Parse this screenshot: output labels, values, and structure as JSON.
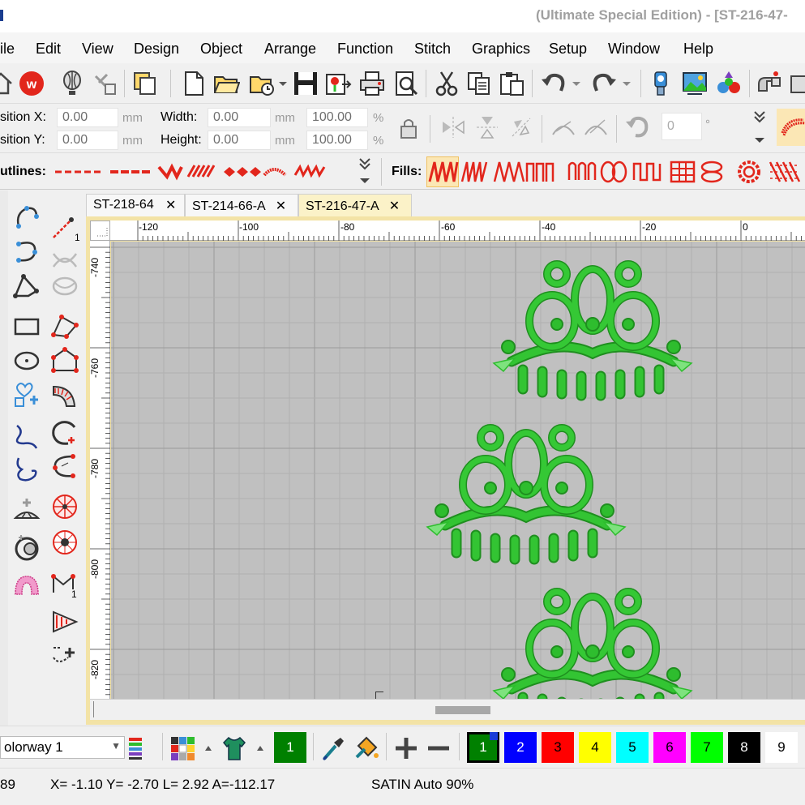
{
  "window": {
    "title": "(Ultimate Special Edition) - [ST-216-47-"
  },
  "menu": [
    "ile",
    "Edit",
    "View",
    "Design",
    "Object",
    "Arrange",
    "Function",
    "Stitch",
    "Graphics",
    "Setup",
    "Window",
    "Help"
  ],
  "properties": {
    "position_x_label": "sition X:",
    "position_x_value": "0.00",
    "position_y_label": "sition Y:",
    "position_y_value": "0.00",
    "width_label": "Width:",
    "width_value": "0.00",
    "width_pct": "100.00",
    "height_label": "Height:",
    "height_value": "0.00",
    "height_pct": "100.00",
    "unit_mm": "mm",
    "unit_pct": "%",
    "rotation_value": "0",
    "rotation_unit": "°"
  },
  "stitchbar": {
    "outlines_label": "utlines:",
    "fills_label": "Fills:"
  },
  "tabs": [
    {
      "label": "ST-218-64",
      "close": "✕"
    },
    {
      "label": "ST-214-66-A",
      "close": "✕"
    },
    {
      "label": "ST-216-47-A",
      "close": "✕"
    }
  ],
  "ruler": {
    "top": [
      "-120",
      "-100",
      "-80",
      "-60",
      "-40",
      "-20",
      "0"
    ],
    "left": [
      "-740",
      "-760",
      "-780",
      "-800",
      "-820"
    ]
  },
  "bottom": {
    "colorway": "olorway 1",
    "selected_color": "1",
    "palette": [
      {
        "label": "1",
        "color": "#008000",
        "text": "#ffffff"
      },
      {
        "label": "2",
        "color": "#0000ff",
        "text": "#ffffff"
      },
      {
        "label": "3",
        "color": "#ff0000",
        "text": "#000000"
      },
      {
        "label": "4",
        "color": "#ffff00",
        "text": "#000000"
      },
      {
        "label": "5",
        "color": "#00ffff",
        "text": "#000000"
      },
      {
        "label": "6",
        "color": "#ff00ff",
        "text": "#000000"
      },
      {
        "label": "7",
        "color": "#00ff00",
        "text": "#000000"
      },
      {
        "label": "8",
        "color": "#000000",
        "text": "#ffffff"
      },
      {
        "label": "9",
        "color": "#ffffff",
        "text": "#000000"
      }
    ]
  },
  "status": {
    "left": "89",
    "coords": "X=  -1.10 Y=  -2.70 L=   2.92 A=-112.17",
    "mode": "SATIN Auto 90%"
  },
  "colors": {
    "embroidery": "#2ebd2e",
    "workspace": "#c0c0c0",
    "accent": "#e2261c"
  }
}
